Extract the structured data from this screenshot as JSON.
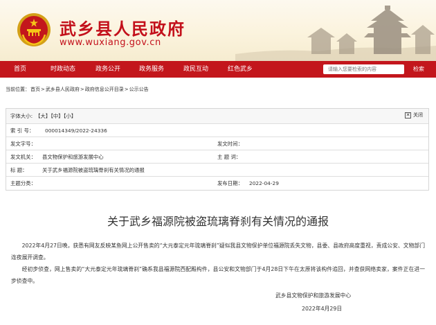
{
  "header": {
    "site_title": "武乡县人民政府",
    "site_url": "www.wuxiang.gov.cn"
  },
  "nav": {
    "items": [
      "首页",
      "时政动态",
      "政务公开",
      "政务服务",
      "政民互动",
      "红色武乡"
    ],
    "search_placeholder": "请输入您要检索的内容",
    "search_button": "检索"
  },
  "breadcrumb": {
    "prefix": "当前位置：",
    "items": [
      "首页",
      "武乡县人民政府",
      "政府信息公开目录",
      "公示公告"
    ],
    "separator": ">"
  },
  "info": {
    "font_size_label": "字体大小:",
    "font_large": "【大】",
    "font_medium": "【中】",
    "font_small": "【小】",
    "close_label": "关闭",
    "index_label": "索  引  号：",
    "index_value": "000014349/2022-24336",
    "doc_no_label": "发文字号：",
    "doc_no_value": "",
    "doc_time_label": "发文时间：",
    "doc_time_value": "",
    "agency_label": "发文机关：",
    "agency_value": "县文物保护和旅游发展中心",
    "topic_label": "主  题  词：",
    "topic_value": "",
    "title_label": "标      题：",
    "title_value": "关于武乡福源院被盗琉璃脊刹有关情况的通报",
    "category_label": "主题分类：",
    "category_value": "",
    "date_label": "发布日期：",
    "date_value": "2022-04-29"
  },
  "article": {
    "title": "关于武乡福源院被盗琉璃脊刹有关情况的通报",
    "paragraphs": [
      "2022年4月27日晚，获悉有网友反映某鱼网上公开售卖的“大元泰定元年琉璃脊刹”疑似我县文物保护单位福源院丢失文物，县委、县政府高度重视，责成公安、文物部门连夜展开调查。",
      "经初步侦查，网上售卖的“大元泰定元年琉璃脊刹”确系我县福源院西配殿构件，县公安和文物部门于4月28日下午在太原将该构件追回，并查获网络卖家，案件正在进一步侦查中。"
    ],
    "signature": "武乡县文物保护和旅游发展中心",
    "sign_date": "2022年4月29日"
  },
  "colors": {
    "brand_red": "#c3161c",
    "title_red": "#c3101b",
    "header_bg": "#fbf3dd"
  }
}
